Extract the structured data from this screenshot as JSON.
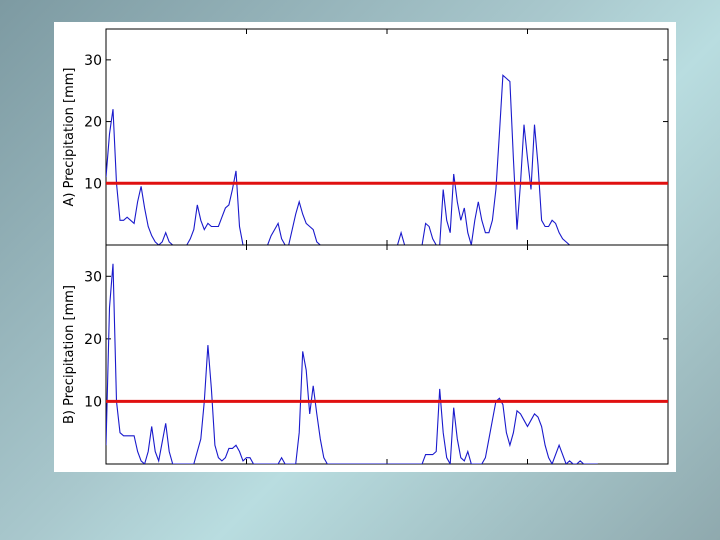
{
  "chart_data": [
    {
      "type": "line",
      "ylabel": "A) Precipitation [mm]",
      "ylim": [
        0,
        35
      ],
      "xlim": [
        0,
        160
      ],
      "yticks": [
        "10",
        "20",
        "30"
      ],
      "threshold": 10,
      "grid": false,
      "series": [
        {
          "color": "#1a1acc",
          "x": [
            0,
            1,
            2,
            3,
            4,
            5,
            6,
            7,
            8,
            9,
            10,
            11,
            12,
            13,
            14,
            15,
            16,
            17,
            18,
            19,
            20,
            21,
            22,
            23,
            24,
            25,
            26,
            27,
            28,
            29,
            30,
            31,
            32,
            33,
            34,
            35,
            36,
            37,
            38,
            39,
            40,
            41,
            42,
            43,
            44,
            45,
            46,
            47,
            48,
            49,
            50,
            51,
            52,
            53,
            54,
            55,
            56,
            57,
            58,
            59,
            60,
            61,
            62,
            63,
            64,
            65,
            66,
            67,
            68,
            69,
            70,
            71,
            72,
            73,
            74,
            75,
            76,
            77,
            78,
            79,
            80,
            81,
            82,
            83,
            84,
            85,
            86,
            87,
            88,
            89,
            90,
            91,
            92,
            93,
            94,
            95,
            96,
            97,
            98,
            99,
            100,
            101,
            102,
            103,
            104,
            105,
            106,
            107,
            108,
            109,
            110,
            111,
            112,
            113,
            114,
            115,
            116,
            117,
            118,
            119,
            120,
            121,
            122,
            123,
            124,
            125,
            126,
            127,
            128,
            129,
            130,
            131,
            132,
            133,
            134,
            135,
            136,
            137,
            138,
            139,
            140
          ],
          "values": [
            11,
            18,
            22,
            10,
            4,
            4,
            4.5,
            4,
            3.5,
            7,
            9.5,
            6,
            3,
            1.5,
            0.5,
            0,
            0.5,
            2,
            0.5,
            0,
            0,
            0,
            0,
            0,
            1,
            2.5,
            6.5,
            4,
            2.5,
            3.5,
            3,
            3,
            3,
            4.5,
            6,
            6.5,
            9,
            12,
            3,
            0,
            0,
            0,
            0,
            0,
            0,
            0,
            0,
            1.5,
            2.5,
            3.5,
            1,
            0,
            0,
            2.5,
            5,
            7,
            5,
            3.5,
            3,
            2.5,
            0.5,
            0,
            0,
            0,
            0,
            0,
            0,
            0,
            0,
            0,
            0,
            0,
            0,
            0,
            0,
            0,
            0,
            0,
            0,
            0,
            0,
            0,
            0,
            0,
            2,
            0,
            0,
            0,
            0,
            0,
            0,
            3.5,
            3,
            1,
            0,
            0,
            9,
            4,
            2,
            11.5,
            7,
            4,
            6,
            2,
            0,
            4,
            7,
            4,
            2,
            2,
            4,
            9,
            18,
            27.5,
            27,
            26.5,
            14,
            2.5,
            10,
            19.5,
            14,
            9,
            19.5,
            13,
            4,
            3,
            3,
            4,
            3.5,
            2,
            1,
            0.5,
            0,
            0,
            0,
            0,
            0,
            0,
            0,
            0,
            0
          ]
        }
      ]
    },
    {
      "type": "line",
      "ylabel": "B) Precipitation [mm]",
      "ylim": [
        0,
        35
      ],
      "xlim": [
        0,
        160
      ],
      "yticks": [
        "10",
        "20",
        "30"
      ],
      "threshold": 10,
      "grid": false,
      "series": [
        {
          "color": "#1a1acc",
          "x": [
            0,
            1,
            2,
            3,
            4,
            5,
            6,
            7,
            8,
            9,
            10,
            11,
            12,
            13,
            14,
            15,
            16,
            17,
            18,
            19,
            20,
            21,
            22,
            23,
            24,
            25,
            26,
            27,
            28,
            29,
            30,
            31,
            32,
            33,
            34,
            35,
            36,
            37,
            38,
            39,
            40,
            41,
            42,
            43,
            44,
            45,
            46,
            47,
            48,
            49,
            50,
            51,
            52,
            53,
            54,
            55,
            56,
            57,
            58,
            59,
            60,
            61,
            62,
            63,
            64,
            65,
            66,
            67,
            68,
            69,
            70,
            71,
            72,
            73,
            74,
            75,
            76,
            77,
            78,
            79,
            80,
            81,
            82,
            83,
            84,
            85,
            86,
            87,
            88,
            89,
            90,
            91,
            92,
            93,
            94,
            95,
            96,
            97,
            98,
            99,
            100,
            101,
            102,
            103,
            104,
            105,
            106,
            107,
            108,
            109,
            110,
            111,
            112,
            113,
            114,
            115,
            116,
            117,
            118,
            119,
            120,
            121,
            122,
            123,
            124,
            125,
            126,
            127,
            128,
            129,
            130,
            131,
            132,
            133,
            134,
            135,
            136,
            137,
            138,
            139,
            140
          ],
          "values": [
            3,
            25,
            32,
            10,
            5,
            4.5,
            4.5,
            4.5,
            4.5,
            2,
            0.5,
            0,
            2,
            6,
            2,
            0.5,
            3.5,
            6.5,
            2,
            0,
            0,
            0,
            0,
            0,
            0,
            0,
            2,
            4,
            10,
            19,
            12,
            3,
            1,
            0.5,
            1,
            2.5,
            2.5,
            3,
            2,
            0.5,
            1,
            1,
            0,
            0,
            0,
            0,
            0,
            0,
            0,
            0,
            1,
            0,
            0,
            0,
            0,
            5,
            18,
            15,
            8,
            12.5,
            8,
            4,
            1,
            0,
            0,
            0,
            0,
            0,
            0,
            0,
            0,
            0,
            0,
            0,
            0,
            0,
            0,
            0,
            0,
            0,
            0,
            0,
            0,
            0,
            0,
            0,
            0,
            0,
            0,
            0,
            0,
            1.5,
            1.5,
            1.5,
            2,
            12,
            5,
            1,
            0,
            9,
            4,
            1,
            0.5,
            2,
            0,
            0,
            0,
            0,
            1,
            4,
            7,
            10,
            10.5,
            9.5,
            5,
            3,
            5,
            8.5,
            8,
            7,
            6,
            7,
            8,
            7.5,
            6,
            3,
            1,
            0,
            1.5,
            3,
            1.5,
            0,
            0.5,
            0,
            0,
            0.5,
            0,
            0,
            0,
            0,
            0
          ]
        }
      ]
    }
  ]
}
